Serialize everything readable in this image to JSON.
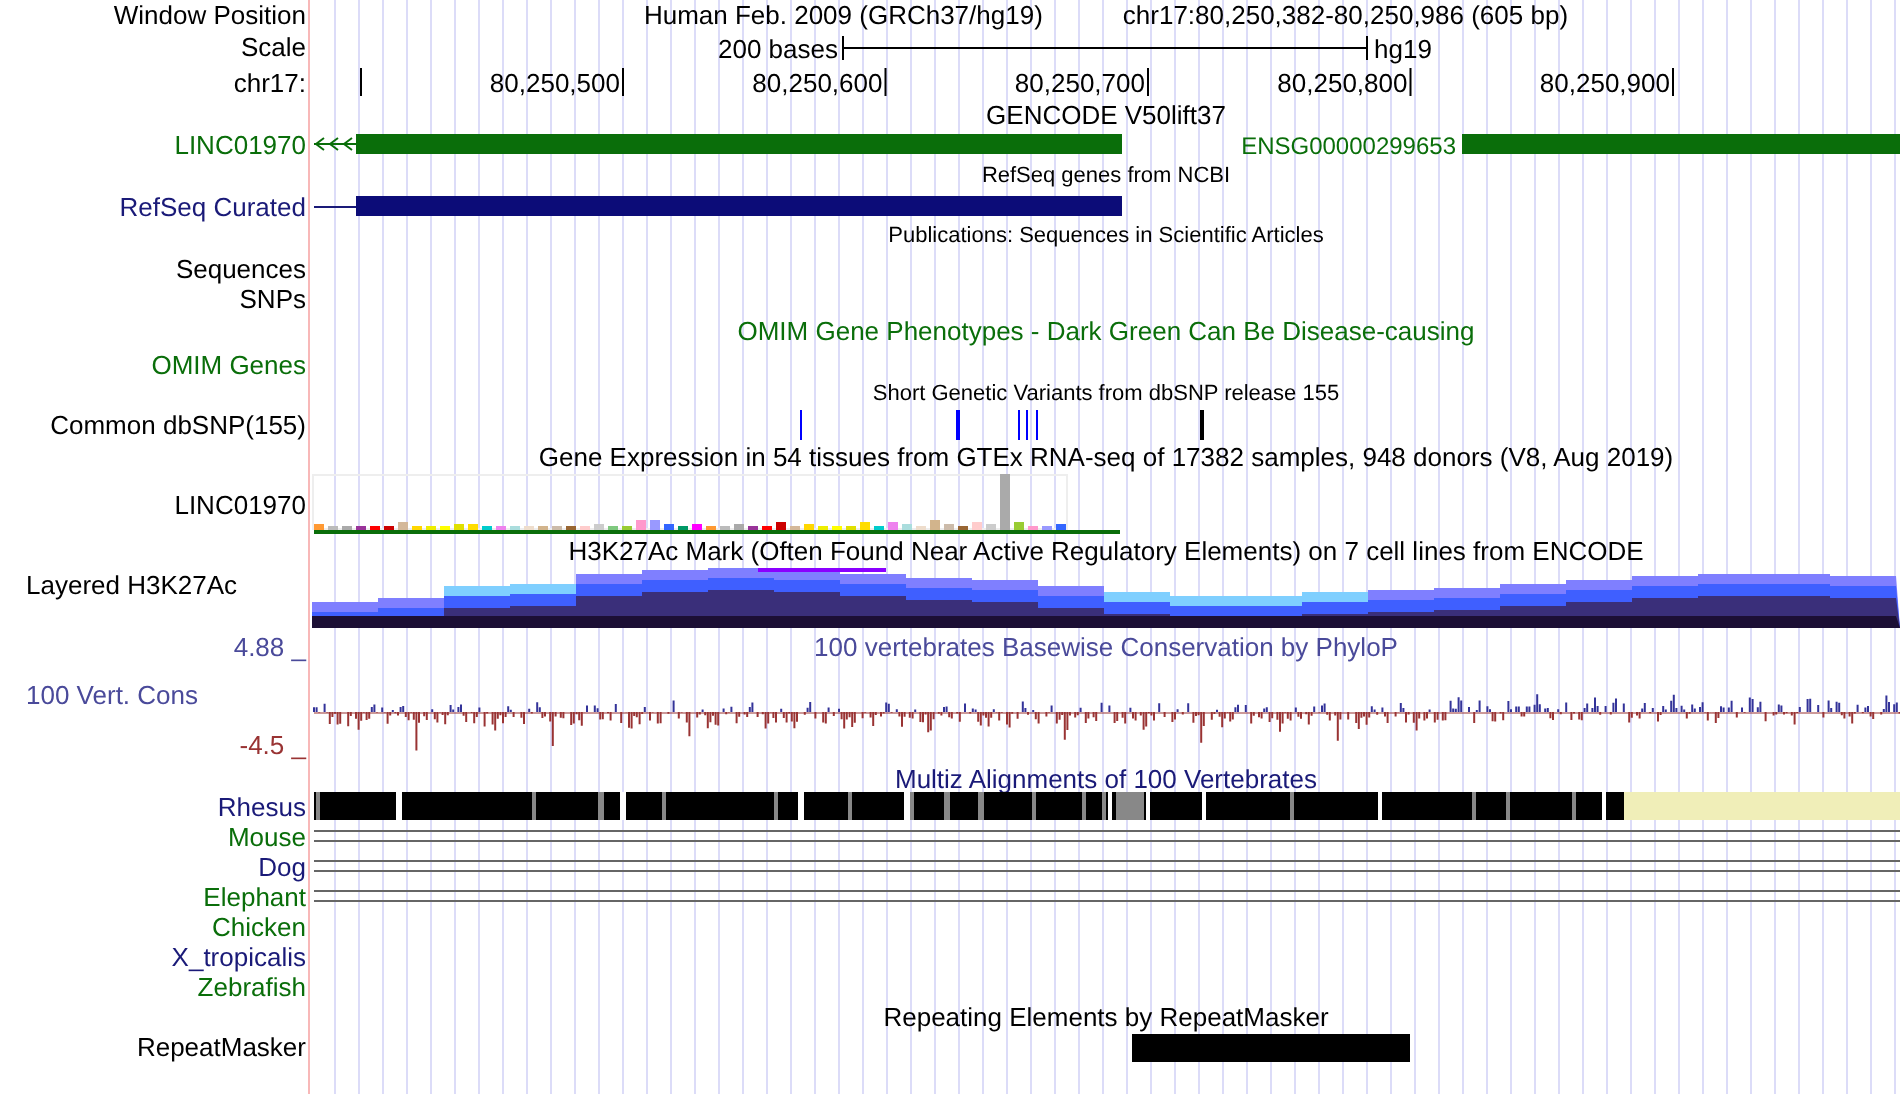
{
  "header": {
    "window_label": "Window Position",
    "title": "Human Feb. 2009 (GRCh37/hg19)",
    "position": "chr17:80,250,382-80,250,986 (605 bp)",
    "scale_label": "Scale",
    "scale_text": "200 bases",
    "assembly": "hg19",
    "ruler_label": "chr17:",
    "ticks": [
      "80,250,500",
      "80,250,600",
      "80,250,700",
      "80,250,800",
      "80,250,900"
    ]
  },
  "tracks": [
    {
      "kind": "gencode",
      "title": "GENCODE V50lift37",
      "label": "LINC01970",
      "color": "#0a6e0a",
      "feature_label": "ENSG00000299653"
    },
    {
      "kind": "refseq",
      "title": "RefSeq genes from NCBI",
      "label": "RefSeq Curated",
      "color": "#1a1a78"
    },
    {
      "kind": "publications",
      "title": "Publications: Sequences in Scientific Articles",
      "labels": [
        "Sequences",
        "SNPs"
      ]
    },
    {
      "kind": "omim",
      "title": "OMIM Gene Phenotypes - Dark Green Can Be Disease-causing",
      "label": "OMIM Genes",
      "color": "#0a6e0a"
    },
    {
      "kind": "dbsnp",
      "title": "Short Genetic Variants from dbSNP release 155",
      "label": "Common dbSNP(155)",
      "color": "#000000"
    },
    {
      "kind": "gtex",
      "title": "Gene Expression in 54 tissues from GTEx RNA-seq of 17382 samples, 948 donors (V8, Aug 2019)",
      "label": "LINC01970",
      "color": "#000000"
    },
    {
      "kind": "h3k27ac",
      "title": "H3K27Ac Mark (Often Found Near Active Regulatory Elements) on 7 cell lines from ENCODE",
      "label": "Layered H3K27Ac",
      "color": "#000000"
    },
    {
      "kind": "phylop",
      "title": "100 vertebrates Basewise Conservation by PhyloP",
      "label": "100 Vert. Cons",
      "color": "#4a4a9a",
      "max": "4.88 _",
      "min": "-4.5 _"
    },
    {
      "kind": "multiz",
      "title": "Multiz Alignments of 100 Vertebrates",
      "species": [
        {
          "name": "Rhesus",
          "color": "#1a1a78",
          "kind": "blocks"
        },
        {
          "name": "Mouse",
          "color": "#0a6e0a",
          "kind": "lines"
        },
        {
          "name": "Dog",
          "color": "#1a1a78",
          "kind": "lines"
        },
        {
          "name": "Elephant",
          "color": "#0a6e0a",
          "kind": "lines"
        },
        {
          "name": "Chicken",
          "color": "#0a6e0a",
          "kind": "none"
        },
        {
          "name": "X_tropicalis",
          "color": "#1a1a78",
          "kind": "none"
        },
        {
          "name": "Zebrafish",
          "color": "#0a6e0a",
          "kind": "none"
        }
      ]
    },
    {
      "kind": "repeatmasker",
      "title": "Repeating Elements by RepeatMasker",
      "label": "RepeatMasker",
      "color": "#000000"
    }
  ]
}
